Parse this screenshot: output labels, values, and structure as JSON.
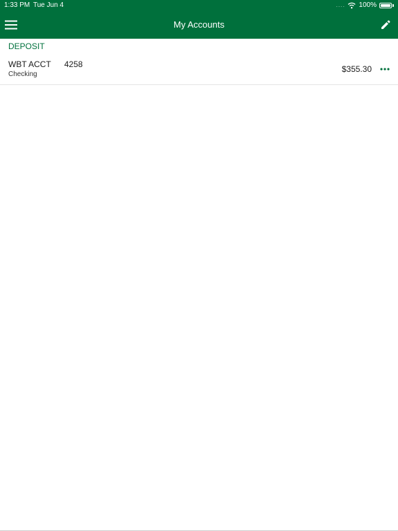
{
  "status_bar": {
    "time": "1:33 PM",
    "date": "Tue Jun 4",
    "signal_dots": "....",
    "battery_percent": "100%",
    "battery_level": 1.0
  },
  "nav": {
    "title": "My Accounts"
  },
  "colors": {
    "brand_green": "#00703c",
    "background": "#ffffff",
    "divider": "#e4e4e4"
  },
  "icons": {
    "menu": "hamburger-menu-icon",
    "edit": "pencil-icon",
    "more": "ellipsis-icon",
    "wifi": "wifi-icon",
    "battery": "battery-icon"
  },
  "sections": [
    {
      "title": "DEPOSIT",
      "accounts": [
        {
          "name": "WBT ACCT",
          "number": "4258",
          "type": "Checking",
          "balance": "$355.30"
        }
      ]
    }
  ]
}
